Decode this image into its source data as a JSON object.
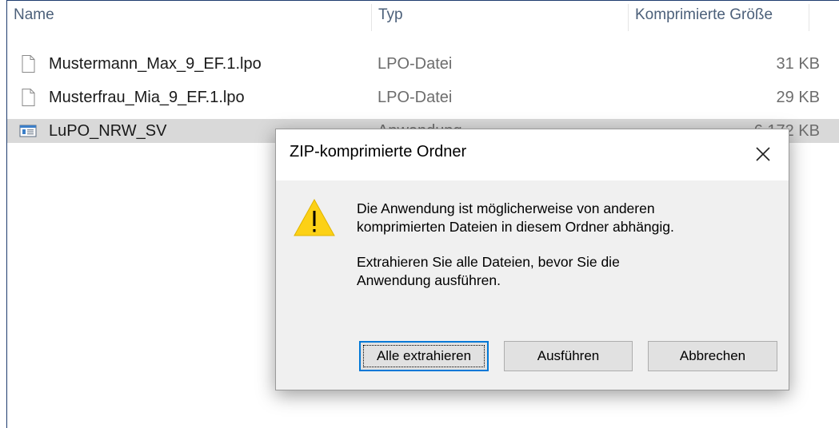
{
  "columns": {
    "name": "Name",
    "type": "Typ",
    "size": "Komprimierte Größe"
  },
  "files": [
    {
      "name": "Mustermann_Max_9_EF.1.lpo",
      "type": "LPO-Datei",
      "size": "31 KB",
      "icon": "document-icon",
      "selected": false
    },
    {
      "name": "Musterfrau_Mia_9_EF.1.lpo",
      "type": "LPO-Datei",
      "size": "29 KB",
      "icon": "document-icon",
      "selected": false
    },
    {
      "name": "LuPO_NRW_SV",
      "type": "Anwendung",
      "size": "6.172 KB",
      "icon": "application-icon",
      "selected": true
    }
  ],
  "dialog": {
    "title": "ZIP-komprimierte Ordner",
    "close_icon": "close-icon",
    "warning_icon": "warning-icon",
    "message_line1": "Die Anwendung ist möglicherweise von anderen",
    "message_line2": "komprimierten Dateien in diesem Ordner abhängig.",
    "message_line3": "Extrahieren Sie alle Dateien, bevor Sie die",
    "message_line4": "Anwendung ausführen.",
    "buttons": {
      "extract_all": "Alle extrahieren",
      "run": "Ausführen",
      "cancel": "Abbrechen"
    }
  },
  "colors": {
    "selection": "#d9d9d9",
    "accent": "#0078d7",
    "warning": "#fcd116"
  }
}
